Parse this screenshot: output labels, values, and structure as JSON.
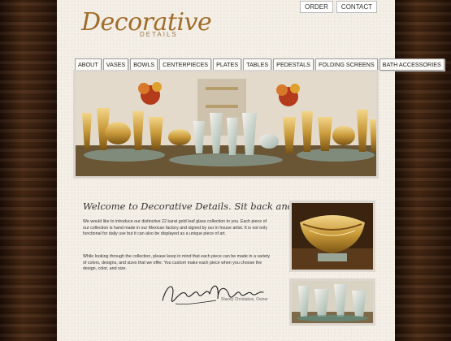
{
  "logo": {
    "title": "Decorative",
    "subtitle": "DETAILS"
  },
  "top_links": [
    "ORDER",
    "CONTACT"
  ],
  "nav": [
    "ABOUT",
    "VASES",
    "BOWLS",
    "CENTERPIECES",
    "PLATES",
    "TABLES",
    "PEDESTALS",
    "FOLDING SCREENS",
    "BATH ACCESSORIES"
  ],
  "welcome": {
    "heading": "Welcome to Decorative Details.  Sit back and enjoy.",
    "paragraph1": "We would like to introduce our distinctive 22 karat gold leaf glass collection to you.  Each piece of our collection is hand made in our Mexican factory and signed by our in house artist.  It is not only functional for daily use but it can also be displayed as a unique piece of art.",
    "paragraph2": "While looking through the collection, please keep in mind that each piece can be made in a variety of colors, designs, and sizes that we offer.  You custom make each piece when you choose the design, color, and size.",
    "signature_caption": "Stacey Christakos, Owner"
  }
}
